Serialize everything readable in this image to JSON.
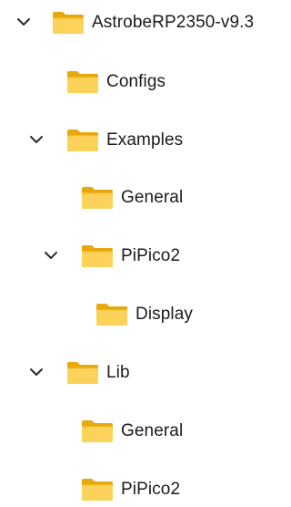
{
  "tree": {
    "items": [
      {
        "label": "AstrobeRP2350-v9.3",
        "expanded": true,
        "icon": "folder-icon"
      },
      {
        "label": "Configs",
        "expanded": false,
        "icon": "folder-icon"
      },
      {
        "label": "Examples",
        "expanded": true,
        "icon": "folder-icon"
      },
      {
        "label": "General",
        "expanded": false,
        "icon": "folder-icon"
      },
      {
        "label": "PiPico2",
        "expanded": true,
        "icon": "folder-icon"
      },
      {
        "label": "Display",
        "expanded": false,
        "icon": "folder-icon"
      },
      {
        "label": "Lib",
        "expanded": true,
        "icon": "folder-icon"
      },
      {
        "label": "General",
        "expanded": false,
        "icon": "folder-icon"
      },
      {
        "label": "PiPico2",
        "expanded": false,
        "icon": "folder-icon"
      }
    ]
  },
  "colors": {
    "folder_back": "#e8a80c",
    "folder_front": "#fbd35a",
    "folder_edge": "#c8900a",
    "chevron": "#2b2b2b",
    "text": "#1b1b1b"
  }
}
